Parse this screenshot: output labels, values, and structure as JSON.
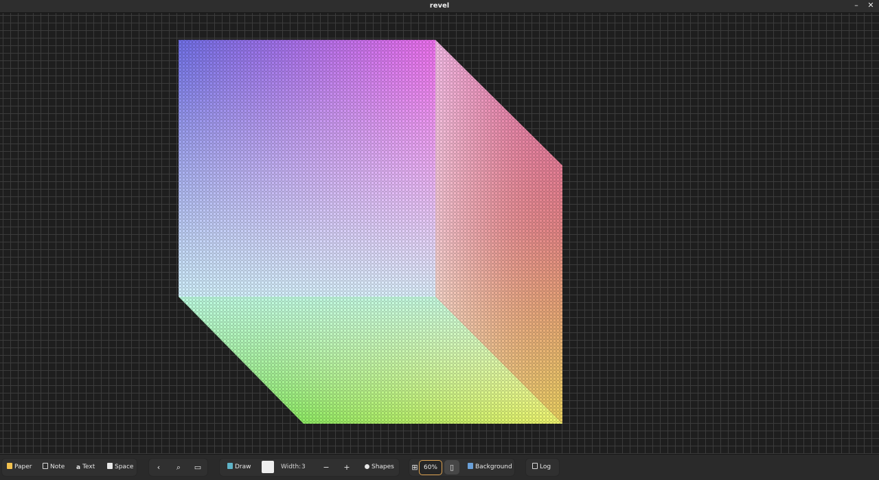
{
  "window": {
    "title": "revel",
    "minimize_icon": "minimize-icon",
    "close_icon": "close-icon"
  },
  "toolbar": {
    "paper_label": "Paper",
    "note_label": "Note",
    "text_label": "Text",
    "space_label": "Space",
    "draw_label": "Draw",
    "width_label": "Width:",
    "width_value": "3",
    "minus_label": "−",
    "plus_label": "+",
    "shapes_label": "Shapes",
    "zoom_value": "60%",
    "background_label": "Background",
    "log_label": "Log",
    "brush_color": "#eeeeee",
    "accent_color": "#e0a552"
  },
  "canvas": {
    "grid_minor_color": "#3c3c3c",
    "grid_major_color": "#575757",
    "content": "rgb-color-cube"
  }
}
